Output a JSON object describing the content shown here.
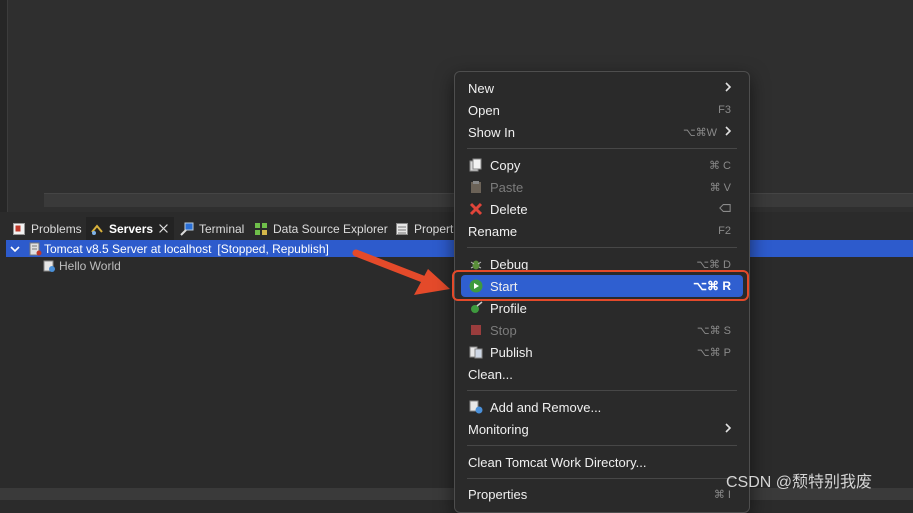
{
  "tabs": [
    {
      "label": "Problems"
    },
    {
      "label": "Servers"
    },
    {
      "label": "Terminal"
    },
    {
      "label": "Data Source Explorer"
    },
    {
      "label": "Propert"
    }
  ],
  "tree": {
    "server_label": "Tomcat v8.5 Server at localhost",
    "server_status": "[Stopped, Republish]",
    "child_label": "Hello World"
  },
  "menu": {
    "new": {
      "label": "New"
    },
    "open": {
      "label": "Open",
      "shortcut": "F3"
    },
    "show_in": {
      "label": "Show In",
      "shortcut": "⌥⌘W"
    },
    "copy": {
      "label": "Copy",
      "shortcut": "⌘ C"
    },
    "paste": {
      "label": "Paste",
      "shortcut": "⌘ V"
    },
    "delete": {
      "label": "Delete"
    },
    "rename": {
      "label": "Rename",
      "shortcut": "F2"
    },
    "debug": {
      "label": "Debug",
      "shortcut": "⌥⌘ D"
    },
    "start": {
      "label": "Start",
      "shortcut": "⌥⌘ R"
    },
    "profile": {
      "label": "Profile"
    },
    "stop": {
      "label": "Stop",
      "shortcut": "⌥⌘ S"
    },
    "publish": {
      "label": "Publish",
      "shortcut": "⌥⌘ P"
    },
    "clean": {
      "label": "Clean..."
    },
    "add_remove": {
      "label": "Add and Remove..."
    },
    "monitoring": {
      "label": "Monitoring"
    },
    "clean_tomcat": {
      "label": "Clean Tomcat Work Directory..."
    },
    "properties": {
      "label": "Properties",
      "shortcut": "⌘ I"
    }
  },
  "watermark": "CSDN @颓特别我废",
  "colors": {
    "selection": "#2d5bcc",
    "highlight": "#2f5fd0",
    "annotation": "#e44a2a"
  }
}
